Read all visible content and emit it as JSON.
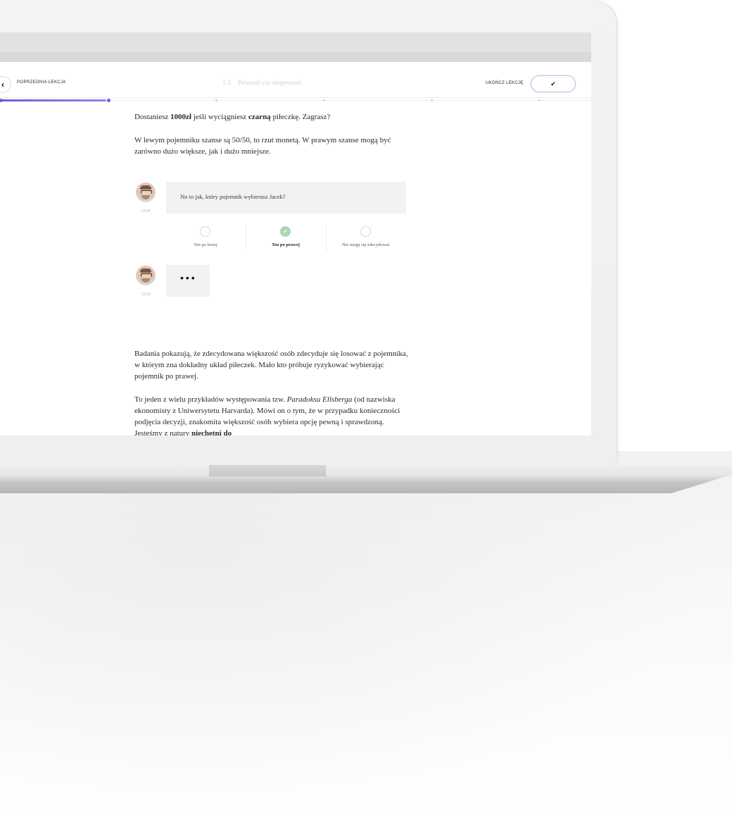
{
  "header": {
    "prev_lesson": "POPRZEDNIA LEKCJA",
    "lesson_number": "1.3.",
    "lesson_title": "Pewność czy niepewność",
    "finish_lesson": "UKOŃCZ LEKCJĘ",
    "finish_icon": "✔",
    "back_icon": "‹"
  },
  "progress": {
    "fraction": 0.18
  },
  "content": {
    "p1_a": "Dostaniesz ",
    "p1_bold1": "1000zł",
    "p1_b": " jeśli wyciągniesz ",
    "p1_bold2": "czarną",
    "p1_c": " piłeczkę. Zagrasz?",
    "p2": "W lewym pojemniku szanse są 50/50, to rzut monetą. W prawym szanse mogą być zarówno dużo większe, jak i dużo mniejsze.",
    "p3": "Badania pokazują, że zdecydowana większość osób zdecyduje się losować z pojemnika, w którym zna dokładny układ piłeczek. Mało kto próbuje ryzykować wybierając pojemnik po prawej.",
    "p4_a": "To jeden z wielu przykładów występowania tzw. ",
    "p4_italic": "Paradoksu Ellsberga",
    "p4_b": " (od nazwiska ekonomisty z Uniwersytetu Harvarda). Mówi on o tym, że w przypadku konieczności podjęcia decyzji, znakomita większość osób wybiera opcję pewną i sprawdzoną. Jesteśmy z natury ",
    "p4_bold": "niechętni do"
  },
  "chat": {
    "message1": "No to jak, który pojemnik wybierasz Jacek?",
    "time1": "13:54",
    "time2": "13:54",
    "typing": "•••"
  },
  "options": [
    {
      "label": "Ten po lewej",
      "selected": false
    },
    {
      "label": "Ten po prawej",
      "selected": true,
      "check": "✔"
    },
    {
      "label": "Nie mogę się zdecydować",
      "selected": false
    }
  ],
  "colors": {
    "accent": "#6c5fd6",
    "check_green": "#a9d8b3",
    "bubble_bg": "#f2f2f2"
  }
}
